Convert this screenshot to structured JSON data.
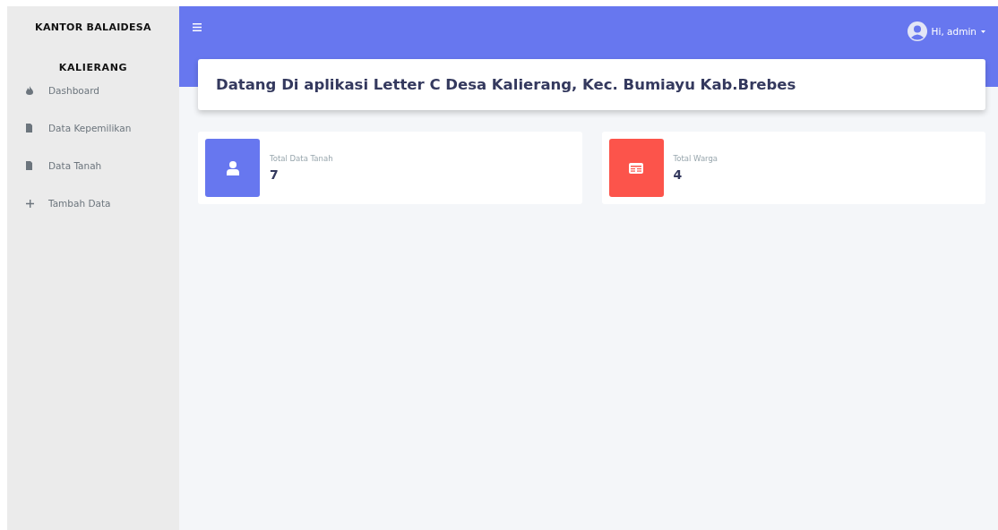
{
  "sidebar": {
    "brand": "KANTOR BALAIDESA",
    "subtitle": "KALIERANG",
    "items": [
      {
        "label": "Dashboard",
        "kind": "fire",
        "selected": false
      },
      {
        "label": "Data Kepemilikan",
        "kind": "file",
        "selected": false
      },
      {
        "label": "Data Tanah",
        "kind": "file",
        "selected": false
      },
      {
        "label": "Tambah Data",
        "kind": "plus",
        "selected": false
      }
    ]
  },
  "navbar": {
    "user": "Hi, admin"
  },
  "welcome": "Datang Di aplikasi Letter C Desa Kalierang, Kec. Bumiayu Kab.Brebes",
  "stats": [
    {
      "label": "Total Data Tanah",
      "value": "7",
      "kind": "user",
      "color": "#6777ef"
    },
    {
      "label": "Total Warga",
      "value": "4",
      "kind": "card",
      "color": "#fc544b"
    }
  ]
}
